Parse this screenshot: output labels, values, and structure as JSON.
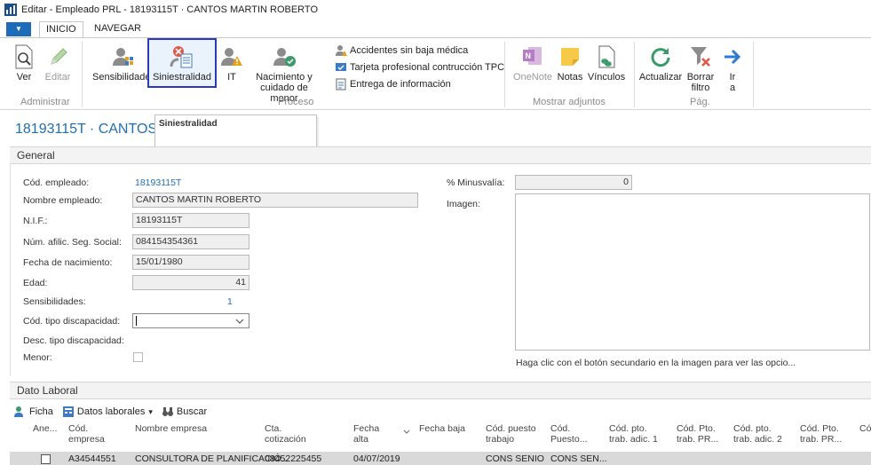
{
  "window": {
    "title": "Editar - Empleado PRL - 18193115T · CANTOS MARTIN ROBERTO"
  },
  "tabs": {
    "menu_arrow": "▼",
    "inicio": "INICIO",
    "navegar": "NAVEGAR"
  },
  "ribbon": {
    "ver": "Ver",
    "editar": "Editar",
    "sensibilidades": "Sensibilidades",
    "siniestralidad": "Siniestralidad",
    "it": "IT",
    "nacimiento_l1": "Nacimiento y",
    "nacimiento_l2": "cuidado de menor",
    "accidentes": "Accidentes sin baja médica",
    "tarjeta": "Tarjeta profesional contrucción TPC",
    "entrega": "Entrega de información",
    "onenote": "OneNote",
    "notas": "Notas",
    "vinculos": "Vínculos",
    "actualizar": "Actualizar",
    "borrar_l1": "Borrar",
    "borrar_l2": "filtro",
    "ir_l1": "Ir",
    "ir_l2": "a",
    "group_administrar": "Administrar",
    "group_proceso": "Proceso",
    "group_adjuntos": "Mostrar adjuntos",
    "group_pag": "Pág."
  },
  "tooltip": {
    "text": "Siniestralidad"
  },
  "page": {
    "title": "18193115T · CANTOS"
  },
  "general": {
    "header": "General",
    "cod_empleado_label": "Cód. empleado:",
    "cod_empleado": "18193115T",
    "nombre_label": "Nombre empleado:",
    "nombre": "CANTOS MARTIN ROBERTO",
    "nif_label": "N.I.F.:",
    "nif": "18193115T",
    "afilic_label": "Núm. afilic. Seg. Social:",
    "afilic": "084154354361",
    "nacimiento_label": "Fecha de nacimiento:",
    "nacimiento": "15/01/1980",
    "edad_label": "Edad:",
    "edad": "41",
    "sensibilidades_label": "Sensibilidades:",
    "sensibilidades": "1",
    "tipo_disc_label": "Cód. tipo discapacidad:",
    "tipo_disc": "",
    "desc_disc_label": "Desc. tipo discapacidad:",
    "menor_label": "Menor:",
    "minusvalia_label": "% Minusvalía:",
    "minusvalia": "0",
    "imagen_label": "Imagen:",
    "imagen_hint": "Haga clic con el botón secundario en la imagen para ver las opcio..."
  },
  "laboral": {
    "header": "Dato Laboral",
    "ficha": "Ficha",
    "datos_laborales": "Datos laborales",
    "dropdown_arrow": "▾",
    "buscar": "Buscar",
    "columns": {
      "ane": "Ane...",
      "cod_empresa_l1": "Cód.",
      "cod_empresa_l2": "empresa",
      "nombre_empresa": "Nombre empresa",
      "cta_l1": "Cta.",
      "cta_l2": "cotización",
      "fecha_alta_l1": "Fecha",
      "fecha_alta_l2": "alta",
      "fecha_baja": "Fecha baja",
      "puesto_l1": "Cód. puesto",
      "puesto_l2": "trabajo",
      "cod_puesto_l1": "Cód.",
      "cod_puesto_l2": "Puesto...",
      "adic1_l1": "Cód. pto.",
      "adic1_l2": "trab. adic. 1",
      "pr1_l1": "Cód. Pto.",
      "pr1_l2": "trab. PR...",
      "adic2_l1": "Cód. pto.",
      "adic2_l2": "trab. adic. 2",
      "pr2_l1": "Cód. Pto.",
      "pr2_l2": "trab. PR...",
      "last": "Có"
    },
    "row": {
      "cod_empresa": "A34544551",
      "nombre_empresa": "CONSULTORA DE PLANIFICACIÓ...",
      "cta": "08452225455",
      "fecha_alta": "04/07/2019",
      "puesto": "CONS SENIO",
      "cod_puesto": "CONS SEN..."
    }
  }
}
